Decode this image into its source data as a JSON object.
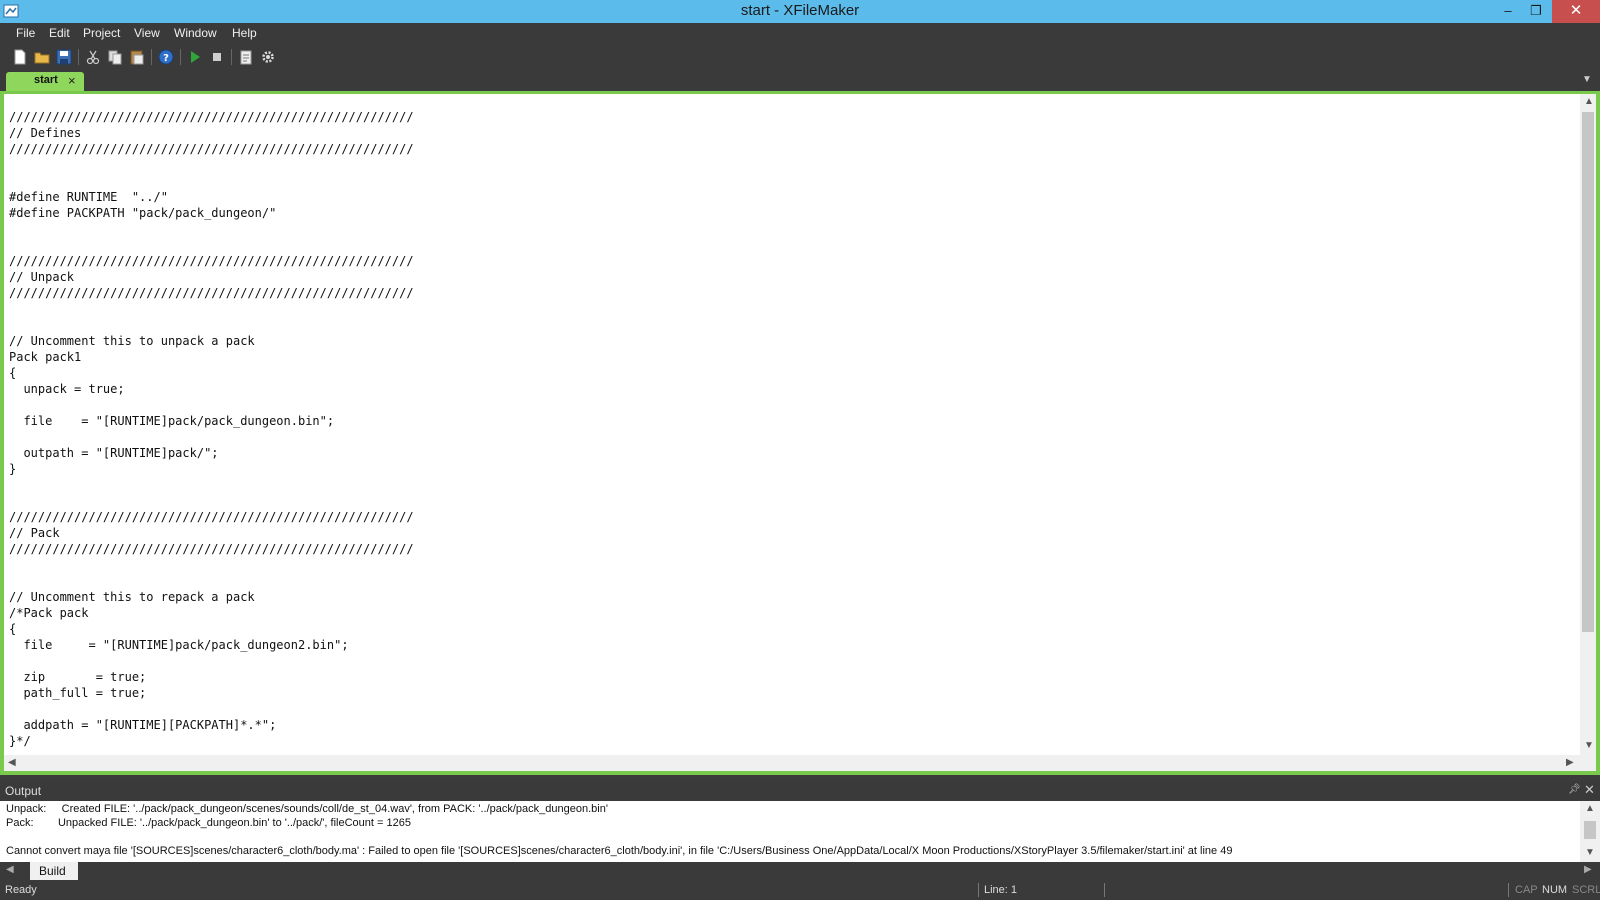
{
  "window": {
    "title": "start - XFileMaker",
    "minimize_glyph": "–",
    "restore_glyph": "❐",
    "close_glyph": "✕"
  },
  "menu": [
    "File",
    "Edit",
    "Project",
    "View",
    "Window",
    "Help"
  ],
  "toolbar": {
    "buttons": [
      "new-file-icon",
      "open-folder-icon",
      "save-icon",
      "cut-icon",
      "copy-icon",
      "paste-icon",
      "help-icon",
      "run-icon",
      "stop-icon",
      "clipboard-icon",
      "settings-gear-icon"
    ]
  },
  "editor": {
    "tab_label": "start",
    "tab_close": "×",
    "dropdown_glyph": "▼",
    "lines": [
      "////////////////////////////////////////////////////////",
      "// Defines",
      "////////////////////////////////////////////////////////",
      "",
      "",
      "#define RUNTIME  \"../\"",
      "#define PACKPATH \"pack/pack_dungeon/\"",
      "",
      "",
      "////////////////////////////////////////////////////////",
      "// Unpack",
      "////////////////////////////////////////////////////////",
      "",
      "",
      "// Uncomment this to unpack a pack",
      "Pack pack1",
      "{",
      "  unpack = true;",
      "",
      "  file    = \"[RUNTIME]pack/pack_dungeon.bin\";",
      "",
      "  outpath = \"[RUNTIME]pack/\";",
      "}",
      "",
      "",
      "////////////////////////////////////////////////////////",
      "// Pack",
      "////////////////////////////////////////////////////////",
      "",
      "",
      "// Uncomment this to repack a pack",
      "/*Pack pack",
      "{",
      "  file     = \"[RUNTIME]pack/pack_dungeon2.bin\";",
      "",
      "  zip       = true;",
      "  path_full = true;",
      "",
      "  addpath = \"[RUNTIME][PACKPATH]*.*\";",
      "}*/"
    ]
  },
  "output": {
    "title": "Output",
    "pin_glyph": "📌",
    "close_glyph": "✕",
    "lines": [
      "Unpack:     Created FILE: '../pack/pack_dungeon/scenes/sounds/coll/de_st_04.wav', from PACK: '../pack/pack_dungeon.bin'",
      "Pack:        Unpacked FILE: '../pack/pack_dungeon.bin' to '../pack/', fileCount = 1265",
      "",
      "Cannot convert maya file '[SOURCES]scenes/character6_cloth/body.ma' : Failed to open file '[SOURCES]scenes/character6_cloth/body.ini', in file 'C:/Users/Business One/AppData/Local/X Moon Productions/XStoryPlayer 3.5/filemaker/start.ini' at line 49"
    ],
    "build_tab": "Build"
  },
  "status": {
    "left": "Ready",
    "line": "Line: 1",
    "cap": "CAP",
    "num": "NUM",
    "scrl": "SCRL"
  },
  "colors": {
    "titlebar": "#5bbbea",
    "tab_active": "#8fd65c",
    "editor_border": "#79c94c",
    "chrome_dark": "#3a3a3a",
    "close_red": "#c7504f"
  }
}
